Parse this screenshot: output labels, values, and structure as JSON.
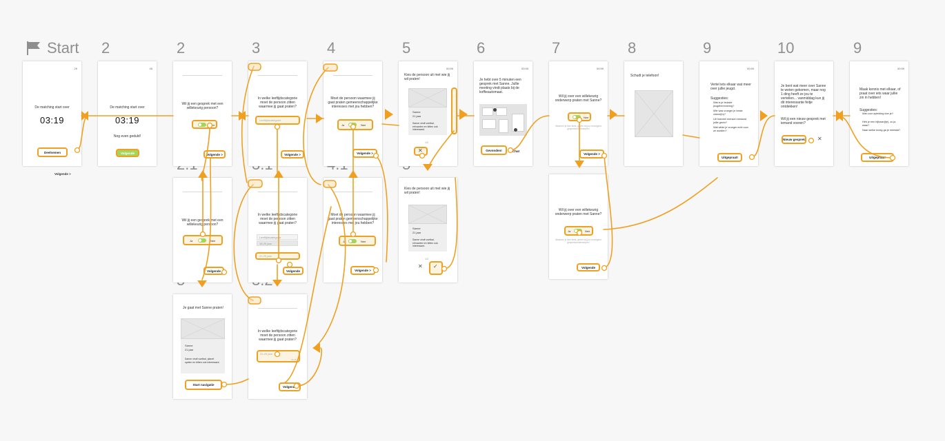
{
  "flow_labels": {
    "start": "Start",
    "s2a": "2",
    "s2b": "2",
    "s3": "3",
    "s4": "4",
    "s5a": "5",
    "s6": "6",
    "s7": "7",
    "s8": "8",
    "s9a": "9",
    "s10": "10",
    "s9b": "9",
    "s21": "2.1",
    "s31": "3.1",
    "s41": "4.1",
    "s5b": "5",
    "s71": "7.1",
    "s5c": "5",
    "s32": "3.2"
  },
  "screens": {
    "start": {
      "time": "29",
      "text": "De matching start over",
      "countdown": "03:19",
      "button": "Deelnemen",
      "below": "Volgende >"
    },
    "s2a": {
      "time": "45",
      "text": "De matching start over",
      "countdown": "03:19",
      "sub": "Nog even geduld!",
      "button": "Volgende"
    },
    "s2b": {
      "question": "Wil jij een gesprek met een willekeurig persoon?",
      "toggle_label": "Nee",
      "button": "Volgende >"
    },
    "s3": {
      "question": "In welke leeftijdscategorie moet de persoon zitten waarmee jij gaat praten?",
      "select": "Leeftijdscategorie",
      "button": "Volgende >"
    },
    "s4": {
      "question": "Moet de persoon waarmee jij gaat praten gemeenschappelijke interesses met jou hebben?",
      "toggle_label": "Nee",
      "toggle_left": "Ja",
      "button": "Volgende >"
    },
    "s5a": {
      "time": "00:59",
      "question": "Kies de persoon uit met wie jij wil praten!",
      "name": "Sanne",
      "age": "21 jaar",
      "desc": "Sanne vindt voetbal, erfvaarten en bitten ook interessant.",
      "counter": "1/3"
    },
    "s6": {
      "time": "00:59",
      "text": "Je hebt over 5 minuten een gesprek met Sanne. Jullie meeting vindt plaats bij de koffieautomaat.",
      "button": "Gevonden!",
      "chat": "Chat"
    },
    "s7": {
      "time": "00:59",
      "question": "Wil jij over een willekeurig onderwerp praten met Sanne?",
      "toggle_label": "Nee",
      "hint": "Wanneer je Nee kiest, geven wij jou vervolgens gespreksonderwerpen!",
      "button": "Volgende >"
    },
    "s8": {
      "text": "Schudt je telefoon!"
    },
    "s9a": {
      "time": "00:59",
      "intro": "Vertel iets elkaar wat meer over jullie jeugd.",
      "sugg_title": "Suggesties:",
      "suggestions": [
        "Wat is je leukste jeugdherinnering?",
        "Wie was vroeger je beste vriend(in)?",
        "Uit hoeveel mensen bestond jullie gezin?",
        "Wat wilde je vroeger echt voor ze worden?"
      ],
      "button": "Uitgepraat!"
    },
    "s10": {
      "text": "Je bent wat meer over Sanne te weten gekomen, maar nog 1 ding heeft ze jou te vertellen... vanmiddag kun jij dit interessante feitje ontdekken!",
      "q": "Wil jij een nieuw gesprek met iemand voeren?",
      "button": "Nieuw gesprek",
      "close": "✕"
    },
    "s9b": {
      "time": "00:59",
      "intro": "Maak kennis met elkaar, of praat over iets waar jullie zin in hebben!",
      "sugg_title": "Suggesties:",
      "suggestions": [
        "Wat voor opleiding doe je?",
        "Heb je een bijbaan(tje), zo ja waar?",
        "Naar welke kroeg ga je meestal?"
      ],
      "button": "Uitgepraat!"
    },
    "s21": {
      "question": "Wil jij een gesprek met een willekeurig persoon?",
      "toggle_left": "Ja",
      "toggle_label": "Nee",
      "button": "Volgende"
    },
    "s31": {
      "question": "In welke leeftijdscategorie moet de persoon zitten waarmee jij gaat praten?",
      "options": [
        "Leeftijdscategorie",
        "18-20 jaar",
        "20-25 jaar"
      ],
      "button": "Volgende"
    },
    "s41": {
      "question": "Moet de persoon waarmee jij gaat praten gemeenschappelijke interesses met jou hebben?",
      "toggle_left": "Ja",
      "toggle_label": "Nee",
      "button": "Volgende >"
    },
    "s5b": {
      "question": "Kies de persoon uit met wie jij wil praten!",
      "name": "Sanne",
      "age": "21 jaar",
      "desc": "Sanne vindt voetbal, erfvaarten en bitten ook interessant.",
      "counter": "1/3",
      "close": "✕",
      "check": "✓"
    },
    "s71": {
      "question": "Wil jij over een willekeurig onderwerp praten met Sanne?",
      "toggle_left": "Ja",
      "toggle_label": "Nee",
      "hint": "Wanneer je Nee kiest, geven wij jou vervolgens gespreksonderwerpen!",
      "button": "Volgende"
    },
    "s5c": {
      "title": "Je gaat met Sanne praten!",
      "name": "Sanne",
      "age": "21 jaar",
      "desc": "Sanne vindt voetbal, planet spelen en bitten ook interessant.",
      "button": "Start navigatie"
    },
    "s32": {
      "question": "In welke leeftijdscategorie moet de persoon zitten waarmee jij gaat praten?",
      "select": "20-25 jaar",
      "select_sub": "21-25",
      "button": "Volgende"
    }
  },
  "colors": {
    "connector": "#f0a020",
    "toggle_on": "#a4d65e",
    "label_gray": "#8f8f8f"
  }
}
